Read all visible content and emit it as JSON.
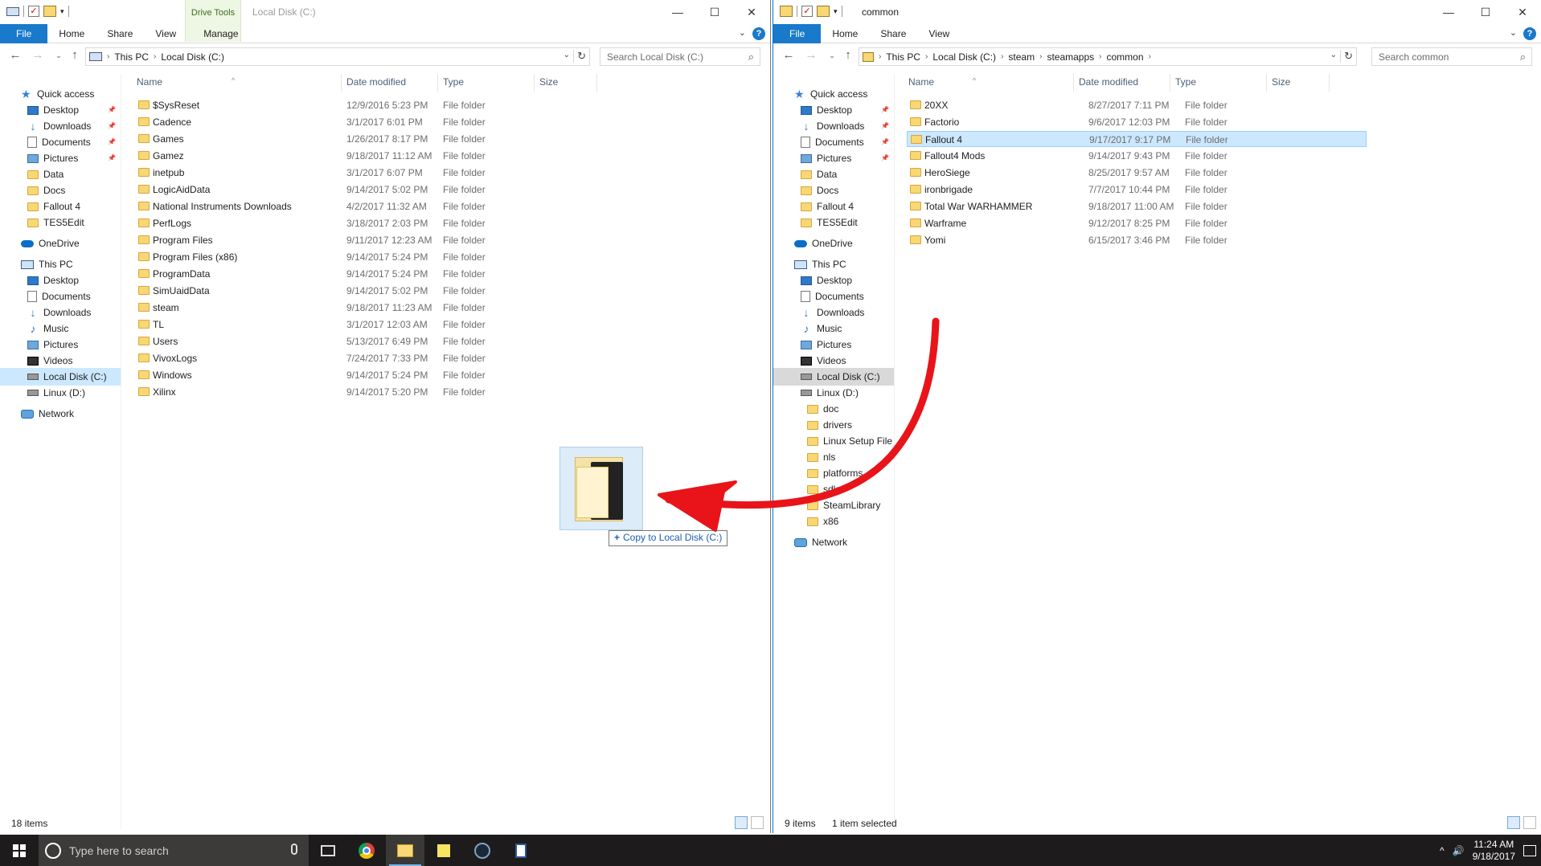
{
  "left_window": {
    "title": "Local Disk (C:)",
    "context_tab_group": "Drive Tools",
    "ribbon_tabs": [
      "File",
      "Home",
      "Share",
      "View",
      "Manage"
    ],
    "address_path": [
      "This PC",
      "Local Disk (C:)"
    ],
    "search_placeholder": "Search Local Disk (C:)",
    "columns": [
      "Name",
      "Date modified",
      "Type",
      "Size"
    ],
    "files": [
      {
        "name": "$SysReset",
        "date": "12/9/2016 5:23 PM",
        "type": "File folder"
      },
      {
        "name": "Cadence",
        "date": "3/1/2017 6:01 PM",
        "type": "File folder"
      },
      {
        "name": "Games",
        "date": "1/26/2017 8:17 PM",
        "type": "File folder"
      },
      {
        "name": "Gamez",
        "date": "9/18/2017 11:12 AM",
        "type": "File folder"
      },
      {
        "name": "inetpub",
        "date": "3/1/2017 6:07 PM",
        "type": "File folder"
      },
      {
        "name": "LogicAidData",
        "date": "9/14/2017 5:02 PM",
        "type": "File folder"
      },
      {
        "name": "National Instruments Downloads",
        "date": "4/2/2017 11:32 AM",
        "type": "File folder"
      },
      {
        "name": "PerfLogs",
        "date": "3/18/2017 2:03 PM",
        "type": "File folder"
      },
      {
        "name": "Program Files",
        "date": "9/11/2017 12:23 AM",
        "type": "File folder"
      },
      {
        "name": "Program Files (x86)",
        "date": "9/14/2017 5:24 PM",
        "type": "File folder"
      },
      {
        "name": "ProgramData",
        "date": "9/14/2017 5:24 PM",
        "type": "File folder"
      },
      {
        "name": "SimUaidData",
        "date": "9/14/2017 5:02 PM",
        "type": "File folder"
      },
      {
        "name": "steam",
        "date": "9/18/2017 11:23 AM",
        "type": "File folder"
      },
      {
        "name": "TL",
        "date": "3/1/2017 12:03 AM",
        "type": "File folder"
      },
      {
        "name": "Users",
        "date": "5/13/2017 6:49 PM",
        "type": "File folder"
      },
      {
        "name": "VivoxLogs",
        "date": "7/24/2017 7:33 PM",
        "type": "File folder"
      },
      {
        "name": "Windows",
        "date": "9/14/2017 5:24 PM",
        "type": "File folder"
      },
      {
        "name": "Xilinx",
        "date": "9/14/2017 5:20 PM",
        "type": "File folder"
      }
    ],
    "nav": [
      {
        "label": "Quick access",
        "icon": "star-icon"
      },
      {
        "label": "Desktop",
        "icon": "desktop-icon",
        "pinned": true
      },
      {
        "label": "Downloads",
        "icon": "download-icon",
        "pinned": true
      },
      {
        "label": "Documents",
        "icon": "documents-icon",
        "pinned": true
      },
      {
        "label": "Pictures",
        "icon": "pictures-icon",
        "pinned": true
      },
      {
        "label": "Data",
        "icon": "folder-icon"
      },
      {
        "label": "Docs",
        "icon": "folder-icon"
      },
      {
        "label": "Fallout 4",
        "icon": "folder-icon"
      },
      {
        "label": "TES5Edit",
        "icon": "folder-icon"
      },
      {
        "label": "OneDrive",
        "icon": "cloud-icon"
      },
      {
        "label": "This PC",
        "icon": "computer-icon"
      },
      {
        "label": "Desktop",
        "icon": "desktop-icon"
      },
      {
        "label": "Documents",
        "icon": "documents-icon"
      },
      {
        "label": "Downloads",
        "icon": "download-icon"
      },
      {
        "label": "Music",
        "icon": "music-icon"
      },
      {
        "label": "Pictures",
        "icon": "pictures-icon"
      },
      {
        "label": "Videos",
        "icon": "videos-icon"
      },
      {
        "label": "Local Disk (C:)",
        "icon": "drive-icon",
        "selected": true
      },
      {
        "label": "Linux (D:)",
        "icon": "drive-icon"
      },
      {
        "label": "Network",
        "icon": "network-icon"
      }
    ],
    "status": "18 items"
  },
  "right_window": {
    "title": "common",
    "ribbon_tabs": [
      "File",
      "Home",
      "Share",
      "View"
    ],
    "address_path": [
      "This PC",
      "Local Disk (C:)",
      "steam",
      "steamapps",
      "common"
    ],
    "search_placeholder": "Search common",
    "columns": [
      "Name",
      "Date modified",
      "Type",
      "Size"
    ],
    "files": [
      {
        "name": "20XX",
        "date": "8/27/2017 7:11 PM",
        "type": "File folder"
      },
      {
        "name": "Factorio",
        "date": "9/6/2017 12:03 PM",
        "type": "File folder"
      },
      {
        "name": "Fallout 4",
        "date": "9/17/2017 9:17 PM",
        "type": "File folder",
        "selected": true
      },
      {
        "name": "Fallout4 Mods",
        "date": "9/14/2017 9:43 PM",
        "type": "File folder"
      },
      {
        "name": "HeroSiege",
        "date": "8/25/2017 9:57 AM",
        "type": "File folder"
      },
      {
        "name": "ironbrigade",
        "date": "7/7/2017 10:44 PM",
        "type": "File folder"
      },
      {
        "name": "Total War WARHAMMER",
        "date": "9/18/2017 11:00 AM",
        "type": "File folder"
      },
      {
        "name": "Warframe",
        "date": "9/12/2017 8:25 PM",
        "type": "File folder"
      },
      {
        "name": "Yomi",
        "date": "6/15/2017 3:46 PM",
        "type": "File folder"
      }
    ],
    "nav": [
      {
        "label": "Quick access",
        "icon": "star-icon"
      },
      {
        "label": "Desktop",
        "icon": "desktop-icon",
        "pinned": true
      },
      {
        "label": "Downloads",
        "icon": "download-icon",
        "pinned": true
      },
      {
        "label": "Documents",
        "icon": "documents-icon",
        "pinned": true
      },
      {
        "label": "Pictures",
        "icon": "pictures-icon",
        "pinned": true
      },
      {
        "label": "Data",
        "icon": "folder-icon"
      },
      {
        "label": "Docs",
        "icon": "folder-icon"
      },
      {
        "label": "Fallout 4",
        "icon": "folder-icon"
      },
      {
        "label": "TES5Edit",
        "icon": "folder-icon"
      },
      {
        "label": "OneDrive",
        "icon": "cloud-icon"
      },
      {
        "label": "This PC",
        "icon": "computer-icon"
      },
      {
        "label": "Desktop",
        "icon": "desktop-icon"
      },
      {
        "label": "Documents",
        "icon": "documents-icon"
      },
      {
        "label": "Downloads",
        "icon": "download-icon"
      },
      {
        "label": "Music",
        "icon": "music-icon"
      },
      {
        "label": "Pictures",
        "icon": "pictures-icon"
      },
      {
        "label": "Videos",
        "icon": "videos-icon"
      },
      {
        "label": "Local Disk (C:)",
        "icon": "drive-icon",
        "highlighted": true
      },
      {
        "label": "Linux (D:)",
        "icon": "drive-icon"
      },
      {
        "label": "doc",
        "icon": "folder-icon"
      },
      {
        "label": "drivers",
        "icon": "folder-icon"
      },
      {
        "label": "Linux Setup File",
        "icon": "folder-icon"
      },
      {
        "label": "nls",
        "icon": "folder-icon"
      },
      {
        "label": "platforms",
        "icon": "folder-icon"
      },
      {
        "label": "sdk",
        "icon": "folder-icon"
      },
      {
        "label": "SteamLibrary",
        "icon": "folder-icon"
      },
      {
        "label": "x86",
        "icon": "folder-icon"
      },
      {
        "label": "Network",
        "icon": "network-icon"
      }
    ],
    "status_count": "9 items",
    "status_selection": "1 item selected"
  },
  "drag": {
    "tooltip": "Copy to Local Disk (C:)",
    "annotation_color": "#e8141a"
  },
  "taskbar": {
    "search_placeholder": "Type here to search",
    "apps": [
      "task-view-icon",
      "chrome-icon",
      "file-explorer-icon",
      "sticky-notes-icon",
      "steam-icon",
      "document-icon"
    ],
    "time": "11:24 AM",
    "date": "9/18/2017"
  },
  "accent": "#1979ca"
}
